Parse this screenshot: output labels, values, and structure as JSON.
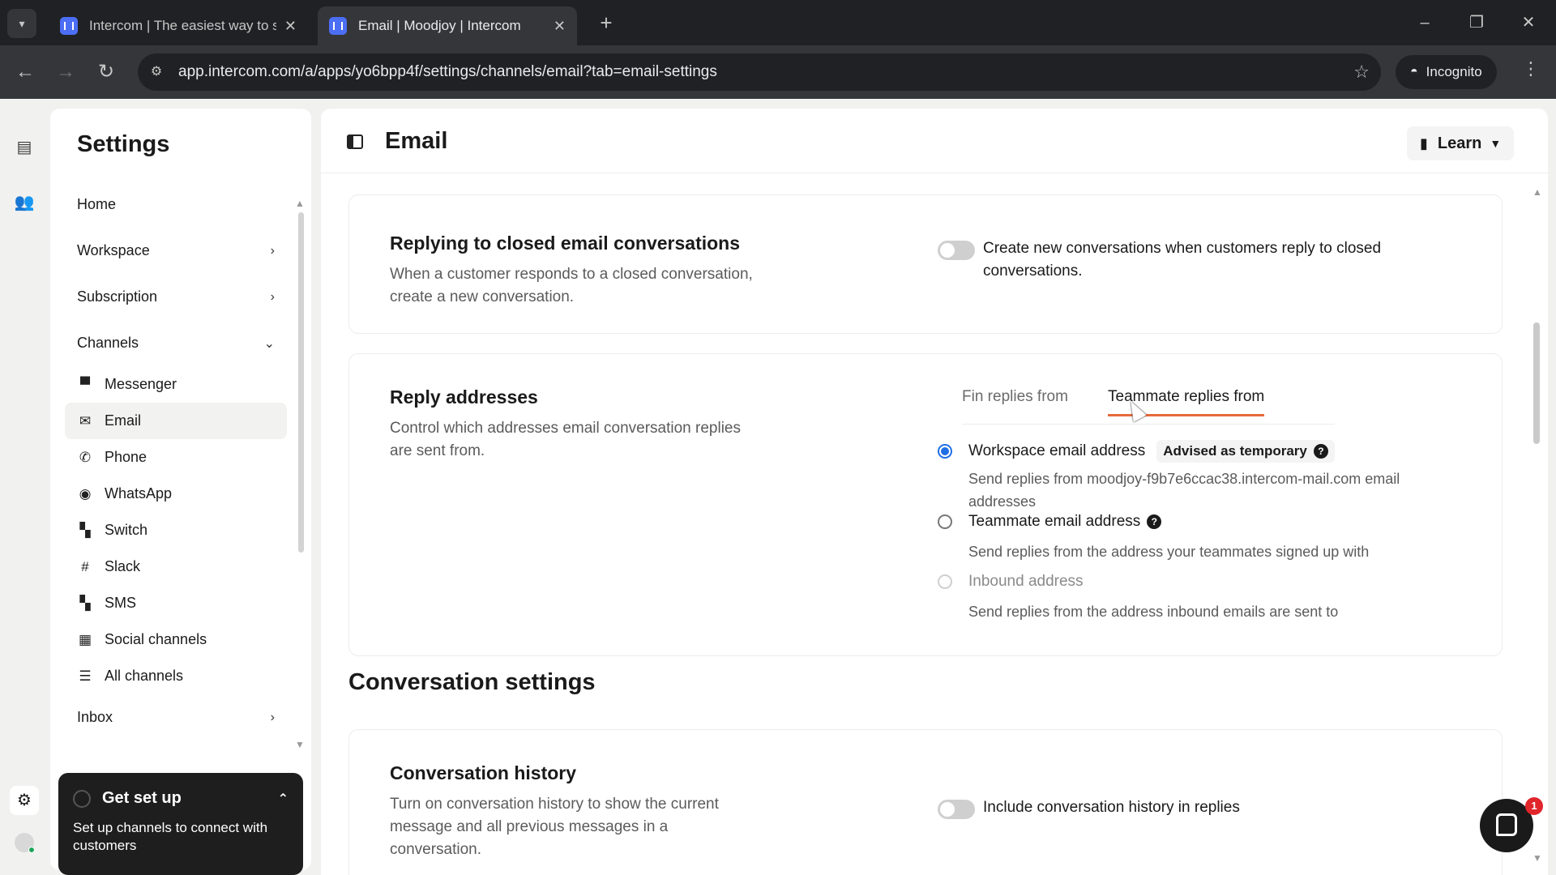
{
  "browser": {
    "tabs": [
      {
        "title": "Intercom | The easiest way to su",
        "close": "✕"
      },
      {
        "title": "Email | Moodjoy | Intercom",
        "close": "✕"
      }
    ],
    "new_tab": "+",
    "url": "app.intercom.com/a/apps/yo6bpp4f/settings/channels/email?tab=email-settings",
    "incognito_label": "Incognito"
  },
  "settings": {
    "title": "Settings",
    "nav": [
      {
        "label": "Home"
      },
      {
        "label": "Workspace"
      },
      {
        "label": "Subscription"
      },
      {
        "label": "Channels"
      }
    ],
    "channels": [
      {
        "label": "Messenger",
        "icon": "messenger-icon"
      },
      {
        "label": "Email",
        "icon": "email-icon",
        "active": true
      },
      {
        "label": "Phone",
        "icon": "phone-icon"
      },
      {
        "label": "WhatsApp",
        "icon": "whatsapp-icon"
      },
      {
        "label": "Switch",
        "icon": "switch-icon"
      },
      {
        "label": "Slack",
        "icon": "slack-icon"
      },
      {
        "label": "SMS",
        "icon": "sms-icon"
      },
      {
        "label": "Social channels",
        "icon": "social-icon"
      },
      {
        "label": "All channels",
        "icon": "list-icon"
      }
    ],
    "inbox": "Inbox",
    "setup": {
      "title": "Get set up",
      "body": "Set up channels to connect with customers"
    }
  },
  "main": {
    "title": "Email",
    "learn": "Learn",
    "closed_replies": {
      "title": "Replying to closed email conversations",
      "desc": "When a customer responds to a closed conversation, create a new conversation.",
      "toggle_label": "Create new conversations when customers reply to closed conversations.",
      "toggle_on": false
    },
    "reply_addresses": {
      "title": "Reply addresses",
      "desc": "Control which addresses email conversation replies are sent from.",
      "tabs": [
        "Fin replies from",
        "Teammate replies from"
      ],
      "active_tab": "Teammate replies from",
      "options": [
        {
          "label": "Workspace email address",
          "badge": "Advised as temporary",
          "desc": "Send replies from moodjoy-f9b7e6ccac38.intercom-mail.com email addresses",
          "selected": true
        },
        {
          "label": "Teammate email address",
          "desc": "Send replies from the address your teammates signed up with",
          "selected": false
        },
        {
          "label": "Inbound address",
          "desc": "Send replies from the address inbound emails are sent to",
          "selected": false,
          "disabled": true
        }
      ]
    },
    "conversation_settings": {
      "title": "Conversation settings",
      "history": {
        "title": "Conversation history",
        "desc": "Turn on conversation history to show the current message and all previous messages in a conversation.",
        "toggle_label": "Include conversation history in replies",
        "toggle_on": false
      }
    },
    "notification_count": "1"
  },
  "colors": {
    "accent": "#1f6fe5",
    "tab_underline": "#e56a3a",
    "chrome_dark": "#202124"
  }
}
